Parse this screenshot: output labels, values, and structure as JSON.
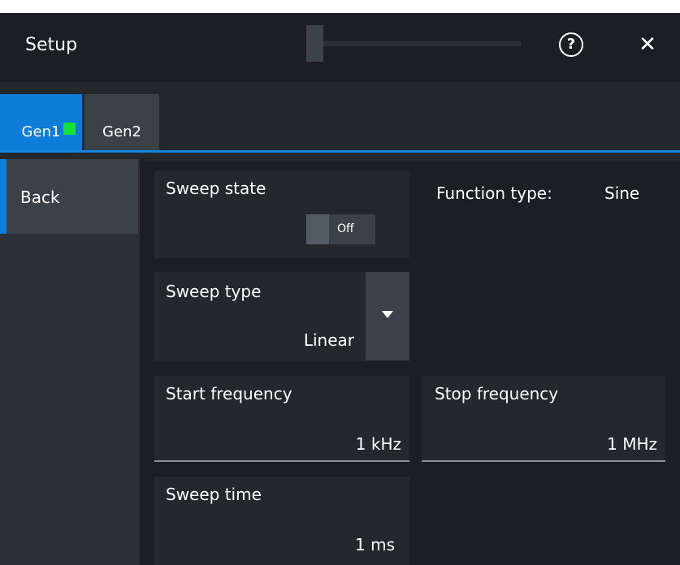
{
  "window": {
    "title": "Setup",
    "help_label": "?",
    "close_label": "✕"
  },
  "tabs": [
    {
      "label": "Gen1",
      "active": true,
      "indicator_color": "#16e23a"
    },
    {
      "label": "Gen2",
      "active": false
    }
  ],
  "sidebar": {
    "back_label": "Back"
  },
  "sweep_state": {
    "label": "Sweep state",
    "value": "Off"
  },
  "function_type": {
    "label": "Function type:",
    "value": "Sine"
  },
  "sweep_type": {
    "label": "Sweep type",
    "value": "Linear"
  },
  "start_frequency": {
    "label": "Start frequency",
    "value": "1 kHz"
  },
  "stop_frequency": {
    "label": "Stop frequency",
    "value": "1 MHz"
  },
  "sweep_time": {
    "label": "Sweep time",
    "value": "1 ms"
  },
  "colors": {
    "accent": "#0d7dd9",
    "background": "#1b1f23",
    "panel": "#23282d"
  }
}
